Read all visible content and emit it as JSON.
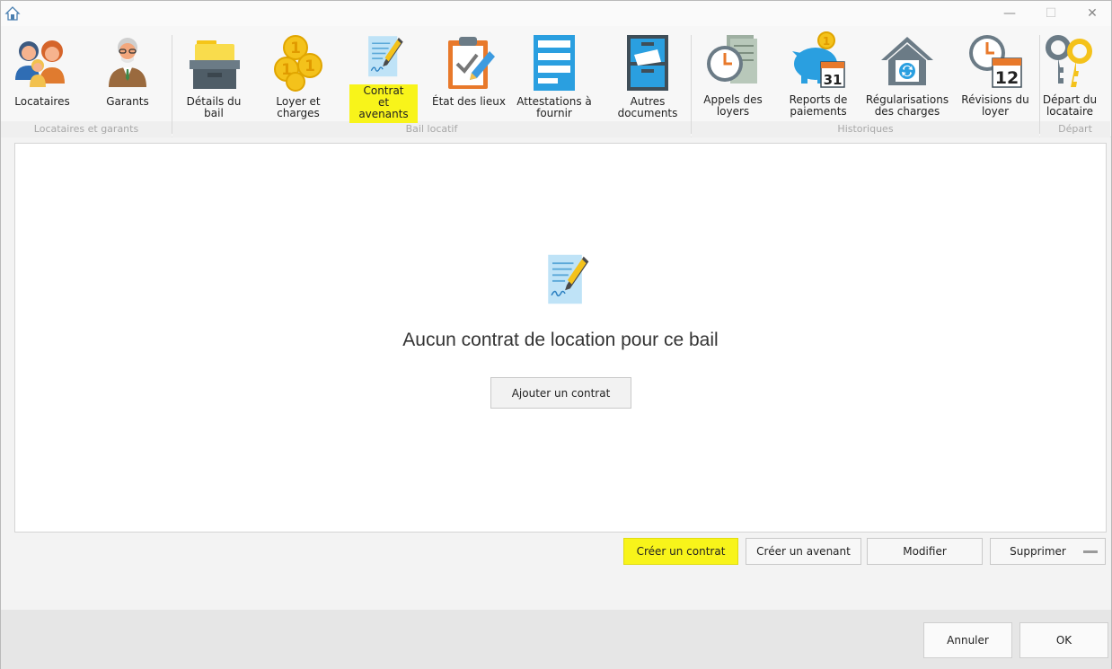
{
  "window": {
    "icon": "house-icon",
    "minimize": "—",
    "maximize": "☐",
    "close": "✕"
  },
  "ribbon": {
    "groups": [
      {
        "label": "Locataires et garants"
      },
      {
        "label": "Bail locatif"
      },
      {
        "label": "Historiques"
      },
      {
        "label": "Départ"
      }
    ],
    "items": [
      {
        "label": "Locataires",
        "icon": "tenants-icon"
      },
      {
        "label": "Garants",
        "icon": "guarantor-icon"
      },
      {
        "label": "Détails du bail",
        "icon": "folder-box-icon"
      },
      {
        "label": "Loyer et\ncharges",
        "icon": "coins-icon"
      },
      {
        "label": "Contrat et\navenants",
        "icon": "contract-icon",
        "highlighted": true
      },
      {
        "label": "État des lieux",
        "icon": "clipboard-check-icon"
      },
      {
        "label": "Attestations à\nfournir",
        "icon": "attestation-icon"
      },
      {
        "label": "Autres\ndocuments",
        "icon": "file-cabinet-icon"
      },
      {
        "label": "Appels des\nloyers",
        "icon": "clock-bills-icon"
      },
      {
        "label": "Reports de\npaiements",
        "icon": "piggy-calendar-icon"
      },
      {
        "label": "Régularisations\ndes charges",
        "icon": "house-refresh-icon"
      },
      {
        "label": "Révisions du\nloyer",
        "icon": "clock-calendar-icon"
      },
      {
        "label": "Départ du\nlocataire",
        "icon": "keys-icon"
      }
    ],
    "calendar_day_1": "31",
    "calendar_day_2": "12"
  },
  "content": {
    "empty_message": "Aucun contrat de location pour ce bail",
    "add_button": "Ajouter un contrat"
  },
  "actions": {
    "create_contract": "Créer un contrat",
    "create_amendment": "Créer un avenant",
    "modify": "Modifier",
    "delete": "Supprimer"
  },
  "footer": {
    "cancel": "Annuler",
    "ok": "OK"
  },
  "colors": {
    "highlight": "#f8f41a",
    "accent_blue": "#2a9fe0",
    "coin_gold": "#f4c21b"
  }
}
